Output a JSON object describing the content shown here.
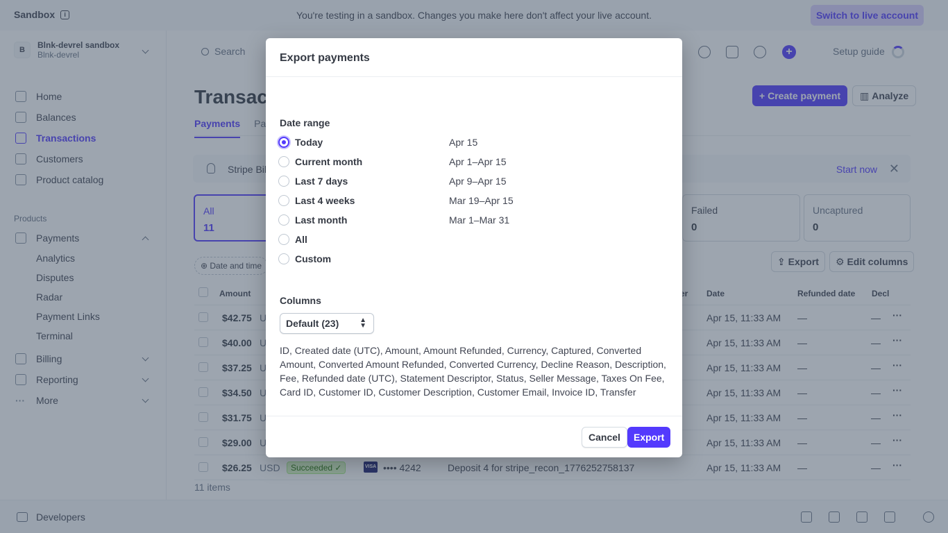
{
  "banner": {
    "brand": "Sandbox",
    "message": "You're testing in a sandbox. Changes you make here don't affect your live account.",
    "live_button": "Switch to live account"
  },
  "account": {
    "initial": "B",
    "name": "Blnk-devrel sandbox",
    "sub": "Blnk-devrel"
  },
  "nav": {
    "home": "Home",
    "balances": "Balances",
    "transactions": "Transactions",
    "customers": "Customers",
    "catalog": "Product catalog",
    "products_section": "Products",
    "payments": "Payments",
    "analytics": "Analytics",
    "disputes": "Disputes",
    "radar": "Radar",
    "payment_links": "Payment Links",
    "terminal": "Terminal",
    "billing": "Billing",
    "reporting": "Reporting",
    "more": "More"
  },
  "bottom": {
    "developers": "Developers"
  },
  "header": {
    "search": "Search",
    "setup": "Setup guide",
    "title": "Transact",
    "create": "Create payment",
    "analyze": "Analyze"
  },
  "tabs": {
    "payments": "Payments",
    "payouts": "Pay"
  },
  "billing": {
    "text": "Stripe Bil",
    "start": "Start now"
  },
  "cards": {
    "all_label": "All",
    "all_value": "11",
    "failed_label": "Failed",
    "failed_value": "0",
    "uncaptured_label": "Uncaptured",
    "uncaptured_value": "0"
  },
  "filter": {
    "date": "Date and time"
  },
  "table_actions": {
    "export": "Export",
    "edit": "Edit columns"
  },
  "table": {
    "headers": {
      "amount": "Amount",
      "er": "er",
      "date": "Date",
      "refunded": "Refunded date",
      "decline": "Decl"
    },
    "rows": [
      {
        "amount": "$42.75",
        "cur": "U",
        "date": "Apr 15, 11:33 AM",
        "r": "—",
        "d": "—"
      },
      {
        "amount": "$40.00",
        "cur": "U",
        "date": "Apr 15, 11:33 AM",
        "r": "—",
        "d": "—"
      },
      {
        "amount": "$37.25",
        "cur": "U",
        "date": "Apr 15, 11:33 AM",
        "r": "—",
        "d": "—"
      },
      {
        "amount": "$34.50",
        "cur": "U",
        "date": "Apr 15, 11:33 AM",
        "r": "—",
        "d": "—"
      },
      {
        "amount": "$31.75",
        "cur": "U",
        "date": "Apr 15, 11:33 AM",
        "r": "—",
        "d": "—"
      },
      {
        "amount": "$29.00",
        "cur": "U",
        "date": "Apr 15, 11:33 AM",
        "r": "—",
        "d": "—"
      },
      {
        "amount": "$26.25",
        "cur": "USD",
        "status": "Succeeded ✓",
        "brand": "VISA",
        "card": "•••• 4242",
        "desc": "Deposit 4 for stripe_recon_1776252758137",
        "date": "Apr 15, 11:33 AM",
        "r": "—",
        "d": "—"
      }
    ],
    "count": "11 items"
  },
  "modal": {
    "title": "Export payments",
    "date_range_label": "Date range",
    "options": [
      {
        "label": "Today",
        "range": "Apr 15",
        "selected": true
      },
      {
        "label": "Current month",
        "range": "Apr 1–Apr 15"
      },
      {
        "label": "Last 7 days",
        "range": "Apr 9–Apr 15"
      },
      {
        "label": "Last 4 weeks",
        "range": "Mar 19–Apr 15"
      },
      {
        "label": "Last month",
        "range": "Mar 1–Mar 31"
      },
      {
        "label": "All",
        "range": ""
      },
      {
        "label": "Custom",
        "range": ""
      }
    ],
    "columns_label": "Columns",
    "columns_select": "Default (23)",
    "columns_text": "ID, Created date (UTC), Amount, Amount Refunded, Currency, Captured, Converted Amount, Converted Amount Refunded, Converted Currency, Decline Reason, Description, Fee, Refunded date (UTC), Statement Descriptor, Status, Seller Message, Taxes On Fee, Card ID, Customer ID, Customer Description, Customer Email, Invoice ID, Transfer",
    "cancel": "Cancel",
    "export": "Export"
  },
  "colors": {
    "accent": "#533afd",
    "overlay": "rgba(60,75,95,0.5)"
  }
}
